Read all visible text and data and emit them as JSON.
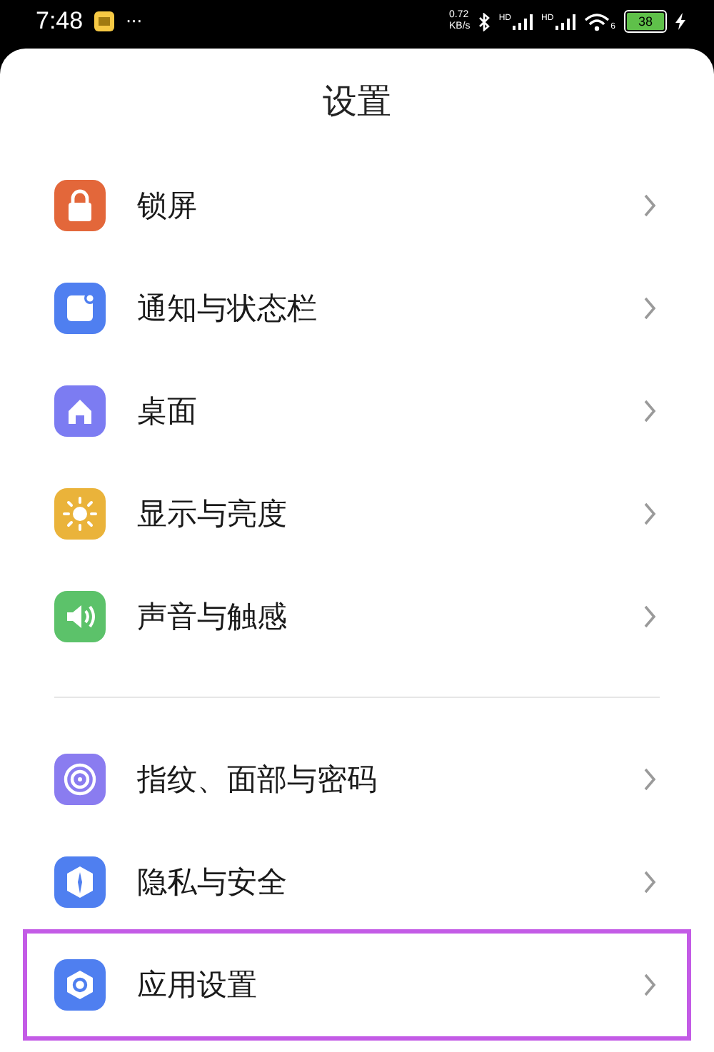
{
  "status_bar": {
    "time": "7:48",
    "more": "···",
    "speed_value": "0.72",
    "speed_unit": "KB/s",
    "signals": [
      {
        "label": "HD"
      },
      {
        "label": "HD"
      }
    ],
    "wifi_label": "6",
    "battery": "38",
    "charging": true
  },
  "title": "设置",
  "groups": [
    {
      "items": [
        {
          "label": "锁屏",
          "kind": "lock",
          "highlighted": false
        },
        {
          "label": "通知与状态栏",
          "kind": "notification",
          "highlighted": false
        },
        {
          "label": "桌面",
          "kind": "home",
          "highlighted": false
        },
        {
          "label": "显示与亮度",
          "kind": "brightness",
          "highlighted": false
        },
        {
          "label": "声音与触感",
          "kind": "sound",
          "highlighted": false
        }
      ]
    },
    {
      "items": [
        {
          "label": "指纹、面部与密码",
          "kind": "fingerprint",
          "highlighted": false
        },
        {
          "label": "隐私与安全",
          "kind": "privacy",
          "highlighted": false
        },
        {
          "label": "应用设置",
          "kind": "app",
          "highlighted": true
        }
      ]
    }
  ]
}
